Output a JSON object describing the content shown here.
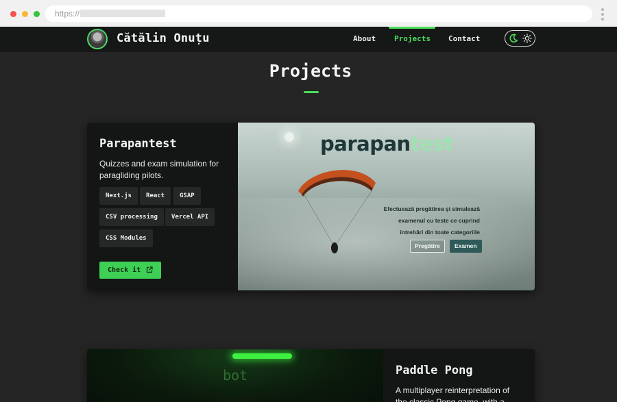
{
  "browser": {
    "url_scheme": "https://"
  },
  "nav": {
    "brand": "Cătălin Onuțu",
    "links": [
      {
        "label": "About"
      },
      {
        "label": "Projects",
        "active": true
      },
      {
        "label": "Contact"
      }
    ],
    "theme_toggle": {
      "icons": [
        "moon-icon",
        "sun-icon"
      ],
      "mode": "dark"
    }
  },
  "page": {
    "title": "Projects"
  },
  "projects": [
    {
      "name": "Parapantest",
      "description": "Quizzes and exam simulation for paragliding pilots.",
      "tags": [
        "Next.js",
        "React",
        "GSAP",
        "CSV processing",
        "Vercel API",
        "CSS Modules"
      ],
      "cta": "Check it",
      "screenshot": {
        "logo_part1": "parapan",
        "logo_part2": "test",
        "tagline_line1": "Efectuează pregătirea și simulează",
        "tagline_line2": "examenul cu teste ce cuprind",
        "tagline_line3": "întrebări din toate categoriile",
        "button1": "Pregătire",
        "button2": "Examen"
      }
    },
    {
      "name": "Paddle Pong",
      "description": "A multiplayer reinterpretation of the classic Pong game, with a twist.",
      "screenshot": {
        "label": "bot"
      }
    }
  ],
  "colors": {
    "accent": "#4ade5a",
    "page_bg": "#252525",
    "nav_bg": "#161717",
    "card_bg": "#141616"
  }
}
